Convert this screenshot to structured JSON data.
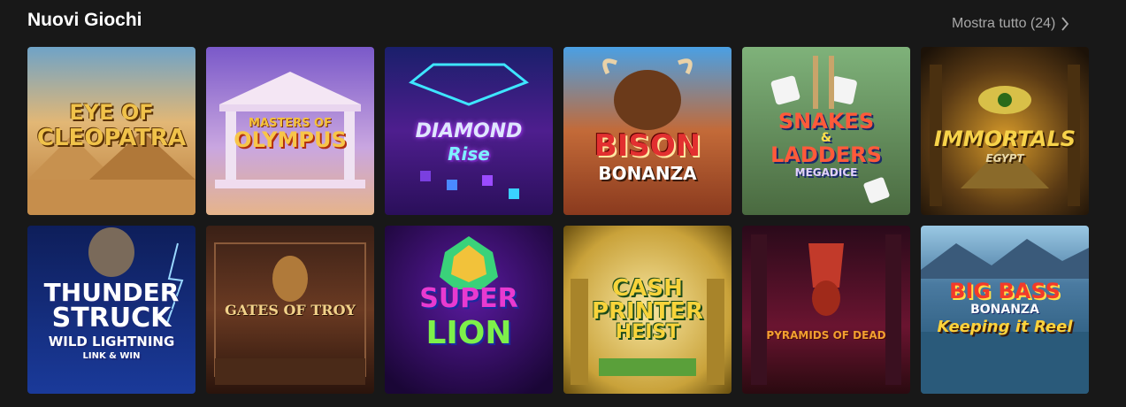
{
  "section": {
    "title": "Nuovi Giochi",
    "show_all": "Mostra tutto (24)"
  },
  "games": [
    {
      "line1": "Eye of",
      "line2": "Cleopatra",
      "line3": ""
    },
    {
      "line1": "Masters of",
      "line2": "Olympus",
      "line3": ""
    },
    {
      "line1": "Diamond",
      "line2": "Rise",
      "line3": ""
    },
    {
      "line1": "Bison",
      "line2": "Bonanza",
      "line3": ""
    },
    {
      "line1": "Snakes",
      "line2": "Ladders",
      "line3": "Megadice"
    },
    {
      "line1": "Immortals",
      "line2": "Egypt",
      "line3": ""
    },
    {
      "line1": "Thunder",
      "line2": "Struck",
      "line3": "Wild Lightning",
      "line4": "Link & Win"
    },
    {
      "line1": "Gates of Troy",
      "line2": "",
      "line3": ""
    },
    {
      "line1": "Super",
      "line2": "Lion",
      "line3": ""
    },
    {
      "line1": "Cash",
      "line2": "Printer",
      "line3": "Heist"
    },
    {
      "line1": "Pyramids of Dead",
      "line2": "",
      "line3": ""
    },
    {
      "line1": "Big Bass",
      "line2": "Bonanza",
      "line3": "Keeping it Reel"
    }
  ],
  "icons": {
    "chevron": "chevron-right-icon"
  }
}
